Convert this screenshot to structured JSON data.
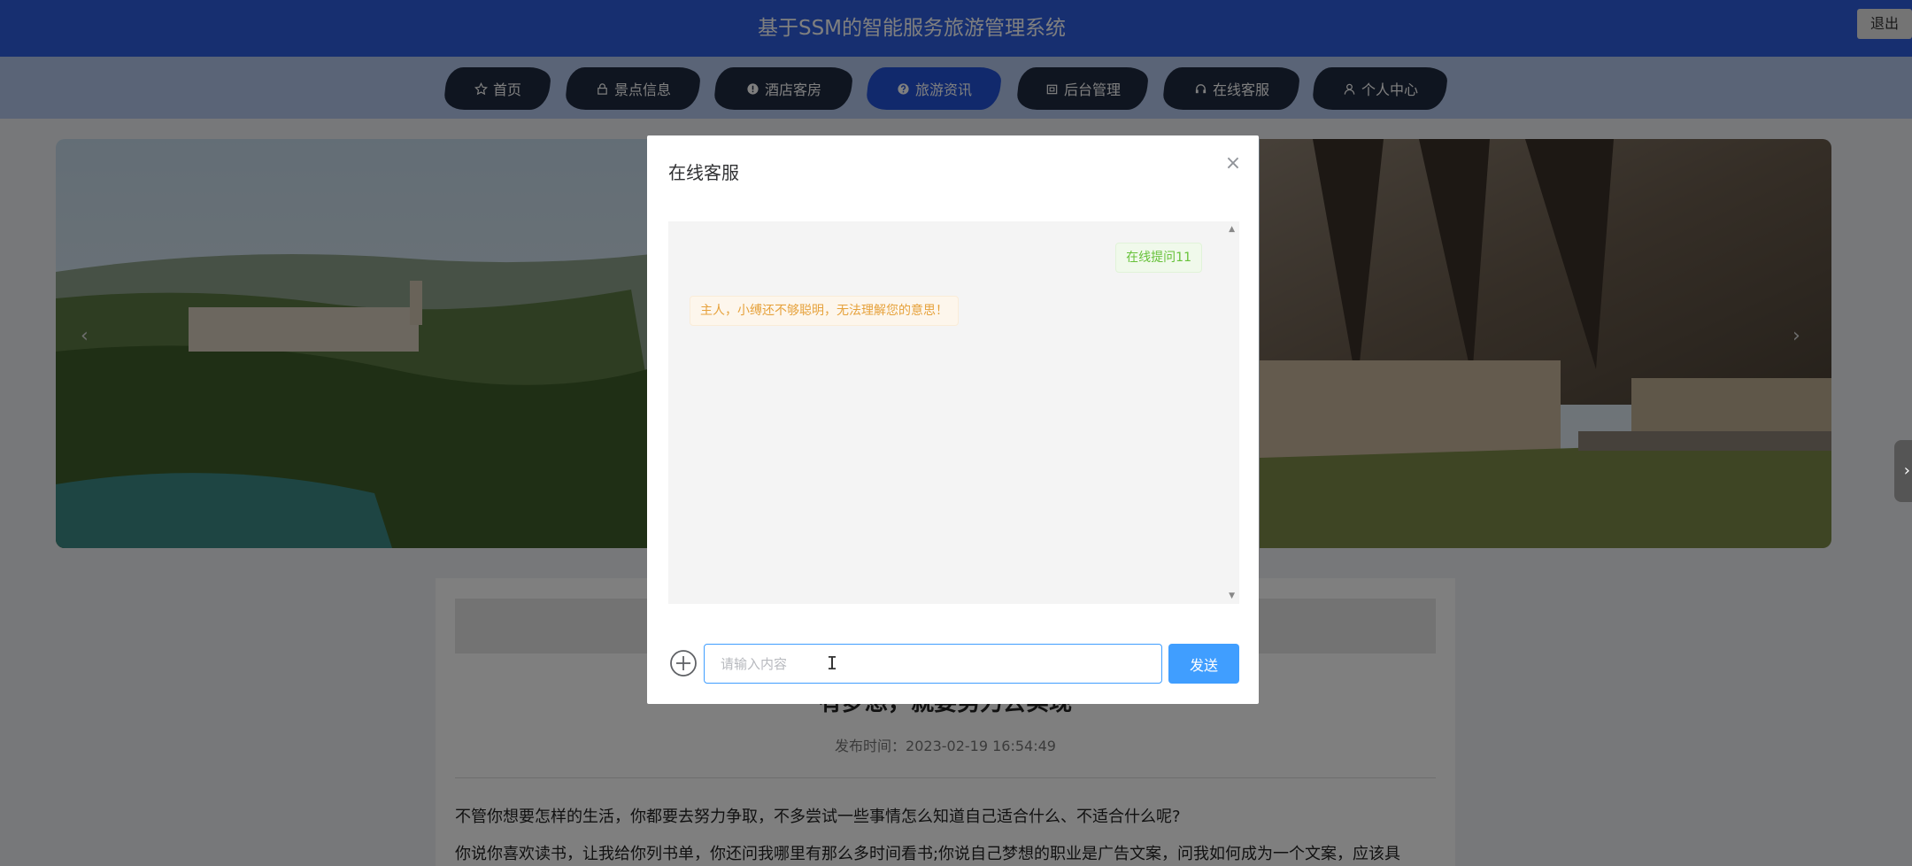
{
  "header": {
    "site_title": "基于SSM的智能服务旅游管理系统",
    "logout_label": "退出"
  },
  "nav": {
    "items": [
      {
        "label": "首页",
        "icon": "star-icon",
        "active": false
      },
      {
        "label": "景点信息",
        "icon": "lock-icon",
        "active": false
      },
      {
        "label": "酒店客房",
        "icon": "info-circle-icon",
        "active": false
      },
      {
        "label": "旅游资讯",
        "icon": "question-circle-icon",
        "active": true
      },
      {
        "label": "后台管理",
        "icon": "wallet-icon",
        "active": false
      },
      {
        "label": "在线客服",
        "icon": "headset-icon",
        "active": false
      },
      {
        "label": "个人中心",
        "icon": "user-icon",
        "active": false
      }
    ]
  },
  "banner": {
    "prev_arrow": "‹",
    "next_arrow": "›"
  },
  "article": {
    "title": "有梦想，就要努力去实现",
    "publish_time": "发布时间：2023-02-19 16:54:49",
    "paragraphs": [
      "不管你想要怎样的生活，你都要去努力争取，不多尝试一些事情怎么知道自己适合什么、不适合什么呢?",
      "你说你喜欢读书，让我给你列书单，你还问我哪里有那么多时间看书;你说自己梦想的职业是广告文案，问我如何成为一个文案，应该具"
    ]
  },
  "dialog": {
    "title": "在线客服",
    "close": "×",
    "messages": {
      "user": "在线提问11",
      "bot": "主人，小缚还不够聪明，无法理解您的意思！"
    },
    "input_placeholder": "请输入内容",
    "send_label": "发送"
  },
  "side_handle": "›",
  "colors": {
    "header": "#2f5fe0",
    "nav_bg": "#b5c9ef",
    "nav_active": "#2252d8",
    "primary": "#409eff",
    "user_msg": "#67c23a",
    "bot_msg": "#e6a23c"
  }
}
